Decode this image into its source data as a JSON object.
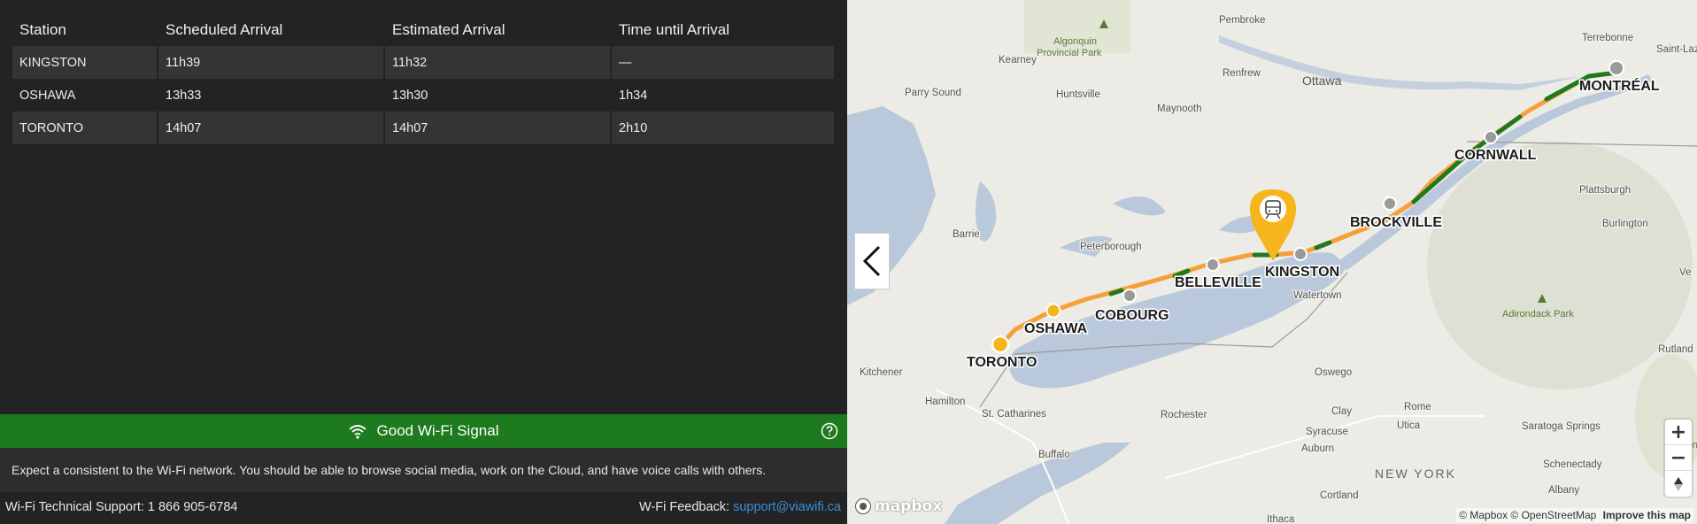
{
  "arrivals": {
    "headers": [
      "Station",
      "Scheduled Arrival",
      "Estimated Arrival",
      "Time until Arrival"
    ],
    "rows": [
      {
        "station": "KINGSTON",
        "scheduled": "11h39",
        "estimated": "11h32",
        "until": "—"
      },
      {
        "station": "OSHAWA",
        "scheduled": "13h33",
        "estimated": "13h30",
        "until": "1h34"
      },
      {
        "station": "TORONTO",
        "scheduled": "14h07",
        "estimated": "14h07",
        "until": "2h10"
      }
    ]
  },
  "wifi": {
    "status_label": "Good Wi-Fi Signal",
    "description": "Expect a consistent to the Wi-Fi network. You should be able to browse social media, work on the Cloud, and have voice calls with others.",
    "bar_color": "#1e7a1e",
    "icon": "wifi-icon",
    "help_icon": "question-circle-icon"
  },
  "footer": {
    "support_text": "Wi-Fi Technical Support: 1 866 905-6784",
    "feedback_label": "W-Fi Feedback: ",
    "feedback_link": "support@viawifi.ca"
  },
  "map": {
    "stations": [
      "MONTRÉAL",
      "CORNWALL",
      "BROCKVILLE",
      "KINGSTON",
      "BELLEVILLE",
      "COBOURG",
      "OSHAWA",
      "TORONTO"
    ],
    "cities": [
      "Terrebonne",
      "Saint-Laz",
      "Pembroke",
      "Renfrew",
      "Ottawa",
      "Kearney",
      "Huntsville",
      "Parry Sound",
      "Maynooth",
      "Plattsburgh",
      "Burlington",
      "Barrie",
      "Peterborough",
      "Watertown",
      "Kitchener",
      "Hamilton",
      "St. Catharines",
      "Rochester",
      "Oswego",
      "Buffalo",
      "Syracuse",
      "Utica",
      "Rome",
      "Clay",
      "Auburn",
      "Saratoga Springs",
      "Schenectady",
      "Albany",
      "Cortland",
      "Ithaca",
      "Rutland",
      "Ve"
    ],
    "parks": [
      "Algonquin Provincial Park",
      "Adirondack Park",
      "Green Nation"
    ],
    "region": "NEW YORK",
    "route_colors": {
      "main": "#f5a03a",
      "on_time": "#1f7a1f"
    },
    "train_icon": "train-pin-icon",
    "zoom_in": "+",
    "zoom_out": "−",
    "compass": "compass-icon",
    "logo_text": "mapbox",
    "attribution": "© Mapbox © OpenStreetMap",
    "improve": "Improve this map"
  }
}
